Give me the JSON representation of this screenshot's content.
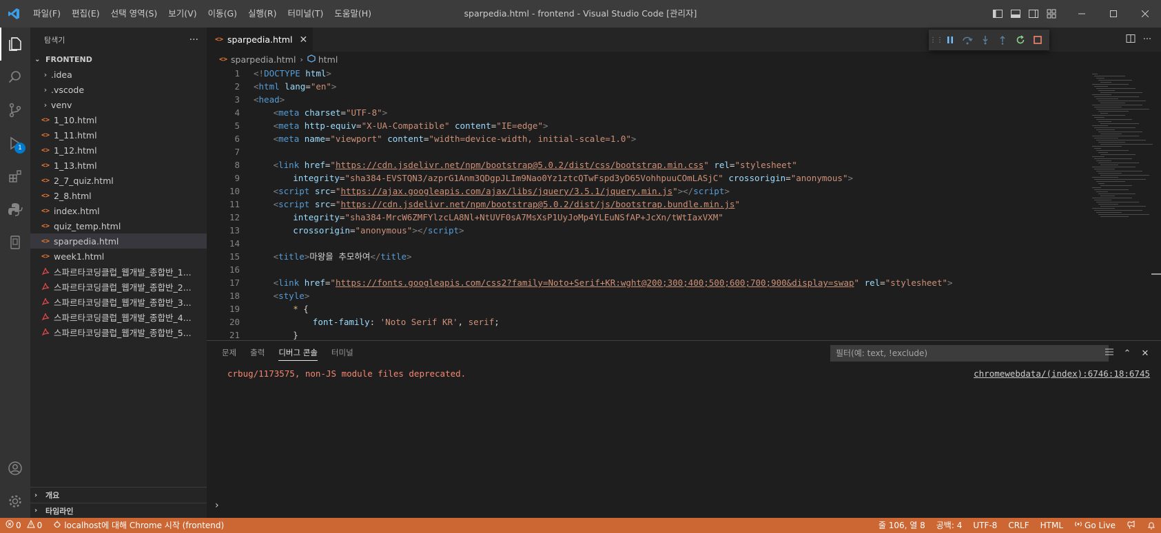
{
  "titlebar": {
    "menu": [
      "파일(F)",
      "편집(E)",
      "선택 영역(S)",
      "보기(V)",
      "이동(G)",
      "실행(R)",
      "터미널(T)",
      "도움말(H)"
    ],
    "window_title": "sparpedia.html - frontend - Visual Studio Code [관리자]"
  },
  "activity": {
    "debug_badge": "1"
  },
  "sidebar": {
    "title": "탐색기",
    "more": "···",
    "root": "FRONTEND",
    "items": [
      {
        "label": ".idea",
        "kind": "folder"
      },
      {
        "label": ".vscode",
        "kind": "folder"
      },
      {
        "label": "venv",
        "kind": "folder"
      },
      {
        "label": "1_10.html",
        "kind": "html"
      },
      {
        "label": "1_11.html",
        "kind": "html"
      },
      {
        "label": "1_12.html",
        "kind": "html"
      },
      {
        "label": "1_13.html",
        "kind": "html"
      },
      {
        "label": "2_7_quiz.html",
        "kind": "html"
      },
      {
        "label": "2_8.html",
        "kind": "html"
      },
      {
        "label": "index.html",
        "kind": "html"
      },
      {
        "label": "quiz_temp.html",
        "kind": "html"
      },
      {
        "label": "sparpedia.html",
        "kind": "html",
        "selected": true
      },
      {
        "label": "week1.html",
        "kind": "html"
      },
      {
        "label": "스파르타코딩클럽_웹개발_종합반_1...",
        "kind": "pdf"
      },
      {
        "label": "스파르타코딩클럽_웹개발_종합반_2...",
        "kind": "pdf"
      },
      {
        "label": "스파르타코딩클럽_웹개발_종합반_3...",
        "kind": "pdf"
      },
      {
        "label": "스파르타코딩클럽_웹개발_종합반_4...",
        "kind": "pdf"
      },
      {
        "label": "스파르타코딩클럽_웹개발_종합반_5...",
        "kind": "pdf"
      }
    ],
    "outline": "개요",
    "timeline": "타임라인"
  },
  "editor": {
    "tab_label": "sparpedia.html",
    "tab_icon": "<>",
    "breadcrumb_file": "sparpedia.html",
    "breadcrumb_symbol": "html",
    "lines": [
      {
        "n": "1",
        "indent": 0,
        "parts": [
          [
            "pu",
            "<!"
          ],
          [
            "tg",
            "DOCTYPE"
          ],
          [
            "tx",
            " "
          ],
          [
            "at",
            "html"
          ],
          [
            "pu",
            ">"
          ]
        ]
      },
      {
        "n": "2",
        "indent": 0,
        "parts": [
          [
            "pu",
            "<"
          ],
          [
            "tg",
            "html"
          ],
          [
            "tx",
            " "
          ],
          [
            "at",
            "lang"
          ],
          [
            "tx",
            "="
          ],
          [
            "st",
            "\"en\""
          ],
          [
            "pu",
            ">"
          ]
        ]
      },
      {
        "n": "3",
        "indent": 0,
        "parts": [
          [
            "pu",
            "<"
          ],
          [
            "tg",
            "head"
          ],
          [
            "pu",
            ">"
          ]
        ]
      },
      {
        "n": "4",
        "indent": 1,
        "parts": [
          [
            "pu",
            "<"
          ],
          [
            "tg",
            "meta"
          ],
          [
            "tx",
            " "
          ],
          [
            "at",
            "charset"
          ],
          [
            "tx",
            "="
          ],
          [
            "st",
            "\"UTF-8\""
          ],
          [
            "pu",
            ">"
          ]
        ]
      },
      {
        "n": "5",
        "indent": 1,
        "parts": [
          [
            "pu",
            "<"
          ],
          [
            "tg",
            "meta"
          ],
          [
            "tx",
            " "
          ],
          [
            "at",
            "http-equiv"
          ],
          [
            "tx",
            "="
          ],
          [
            "st",
            "\"X-UA-Compatible\""
          ],
          [
            "tx",
            " "
          ],
          [
            "at",
            "content"
          ],
          [
            "tx",
            "="
          ],
          [
            "st",
            "\"IE=edge\""
          ],
          [
            "pu",
            ">"
          ]
        ]
      },
      {
        "n": "6",
        "indent": 1,
        "parts": [
          [
            "pu",
            "<"
          ],
          [
            "tg",
            "meta"
          ],
          [
            "tx",
            " "
          ],
          [
            "at",
            "name"
          ],
          [
            "tx",
            "="
          ],
          [
            "st",
            "\"viewport\""
          ],
          [
            "tx",
            " "
          ],
          [
            "at",
            "content"
          ],
          [
            "tx",
            "="
          ],
          [
            "st",
            "\"width=device-width, initial-scale=1.0\""
          ],
          [
            "pu",
            ">"
          ]
        ]
      },
      {
        "n": "7",
        "indent": 0,
        "parts": []
      },
      {
        "n": "8",
        "indent": 1,
        "parts": [
          [
            "pu",
            "<"
          ],
          [
            "tg",
            "link"
          ],
          [
            "tx",
            " "
          ],
          [
            "at",
            "href"
          ],
          [
            "tx",
            "="
          ],
          [
            "st",
            "\""
          ],
          [
            "stu",
            "https://cdn.jsdelivr.net/npm/bootstrap@5.0.2/dist/css/bootstrap.min.css"
          ],
          [
            "st",
            "\""
          ],
          [
            "tx",
            " "
          ],
          [
            "at",
            "rel"
          ],
          [
            "tx",
            "="
          ],
          [
            "st",
            "\"stylesheet\""
          ]
        ]
      },
      {
        "n": "9",
        "indent": 2,
        "parts": [
          [
            "at",
            "integrity"
          ],
          [
            "tx",
            "="
          ],
          [
            "st",
            "\"sha384-EVSTQN3/azprG1Anm3QDgpJLIm9Nao0Yz1ztcQTwFspd3yD65VohhpuuCOmLASjC\""
          ],
          [
            "tx",
            " "
          ],
          [
            "at",
            "crossorigin"
          ],
          [
            "tx",
            "="
          ],
          [
            "st",
            "\"anonymous\""
          ],
          [
            "pu",
            ">"
          ]
        ]
      },
      {
        "n": "10",
        "indent": 1,
        "parts": [
          [
            "pu",
            "<"
          ],
          [
            "tg",
            "script"
          ],
          [
            "tx",
            " "
          ],
          [
            "at",
            "src"
          ],
          [
            "tx",
            "="
          ],
          [
            "st",
            "\""
          ],
          [
            "stu",
            "https://ajax.googleapis.com/ajax/libs/jquery/3.5.1/jquery.min.js"
          ],
          [
            "st",
            "\""
          ],
          [
            "pu",
            "></"
          ],
          [
            "tg",
            "script"
          ],
          [
            "pu",
            ">"
          ]
        ]
      },
      {
        "n": "11",
        "indent": 1,
        "parts": [
          [
            "pu",
            "<"
          ],
          [
            "tg",
            "script"
          ],
          [
            "tx",
            " "
          ],
          [
            "at",
            "src"
          ],
          [
            "tx",
            "="
          ],
          [
            "st",
            "\""
          ],
          [
            "stu",
            "https://cdn.jsdelivr.net/npm/bootstrap@5.0.2/dist/js/bootstrap.bundle.min.js"
          ],
          [
            "st",
            "\""
          ]
        ]
      },
      {
        "n": "12",
        "indent": 2,
        "parts": [
          [
            "at",
            "integrity"
          ],
          [
            "tx",
            "="
          ],
          [
            "st",
            "\"sha384-MrcW6ZMFYlzcLA8Nl+NtUVF0sA7MsXsP1UyJoMp4YLEuNSfAP+JcXn/tWtIaxVXM\""
          ]
        ]
      },
      {
        "n": "13",
        "indent": 2,
        "parts": [
          [
            "at",
            "crossorigin"
          ],
          [
            "tx",
            "="
          ],
          [
            "st",
            "\"anonymous\""
          ],
          [
            "pu",
            "></"
          ],
          [
            "tg",
            "script"
          ],
          [
            "pu",
            ">"
          ]
        ]
      },
      {
        "n": "14",
        "indent": 0,
        "parts": []
      },
      {
        "n": "15",
        "indent": 1,
        "parts": [
          [
            "pu",
            "<"
          ],
          [
            "tg",
            "title"
          ],
          [
            "pu",
            ">"
          ],
          [
            "tx",
            "마왕을 추모하여"
          ],
          [
            "pu",
            "</"
          ],
          [
            "tg",
            "title"
          ],
          [
            "pu",
            ">"
          ]
        ]
      },
      {
        "n": "16",
        "indent": 0,
        "parts": []
      },
      {
        "n": "17",
        "indent": 1,
        "parts": [
          [
            "pu",
            "<"
          ],
          [
            "tg",
            "link"
          ],
          [
            "tx",
            " "
          ],
          [
            "at",
            "href"
          ],
          [
            "tx",
            "="
          ],
          [
            "st",
            "\""
          ],
          [
            "stu",
            "https://fonts.googleapis.com/css2?family=Noto+Serif+KR:wght@200;300;400;500;600;700;900&display=swap"
          ],
          [
            "st",
            "\""
          ],
          [
            "tx",
            " "
          ],
          [
            "at",
            "rel"
          ],
          [
            "tx",
            "="
          ],
          [
            "st",
            "\"stylesheet\""
          ],
          [
            "pu",
            ">"
          ]
        ]
      },
      {
        "n": "18",
        "indent": 1,
        "parts": [
          [
            "pu",
            "<"
          ],
          [
            "tg",
            "style"
          ],
          [
            "pu",
            ">"
          ]
        ]
      },
      {
        "n": "19",
        "indent": 2,
        "parts": [
          [
            "sel",
            "*"
          ],
          [
            "tx",
            " {"
          ]
        ]
      },
      {
        "n": "20",
        "indent": 3,
        "parts": [
          [
            "at",
            "font-family"
          ],
          [
            "tx",
            ": "
          ],
          [
            "st",
            "'Noto Serif KR'"
          ],
          [
            "tx",
            ", "
          ],
          [
            "st",
            "serif"
          ],
          [
            "tx",
            ";"
          ]
        ]
      },
      {
        "n": "21",
        "indent": 2,
        "parts": [
          [
            "tx",
            "}"
          ]
        ]
      }
    ]
  },
  "panel": {
    "tabs": [
      "문제",
      "출력",
      "디버그 콘솔",
      "터미널"
    ],
    "active_tab": 2,
    "filter_placeholder": "필터(예: text, !exclude)",
    "console_message": "crbug/1173575, non-JS module files deprecated.",
    "console_source": "chromewebdata/(index):6746:18:6745",
    "prompt": "›"
  },
  "statusbar": {
    "errors": "0",
    "warnings": "0",
    "debug_session": "localhost에 대해 Chrome 시작 (frontend)",
    "cursor": "줄 106, 열 8",
    "spaces": "공백: 4",
    "encoding": "UTF-8",
    "eol": "CRLF",
    "language": "HTML",
    "golive": "Go Live",
    "color": "#cc6633"
  }
}
